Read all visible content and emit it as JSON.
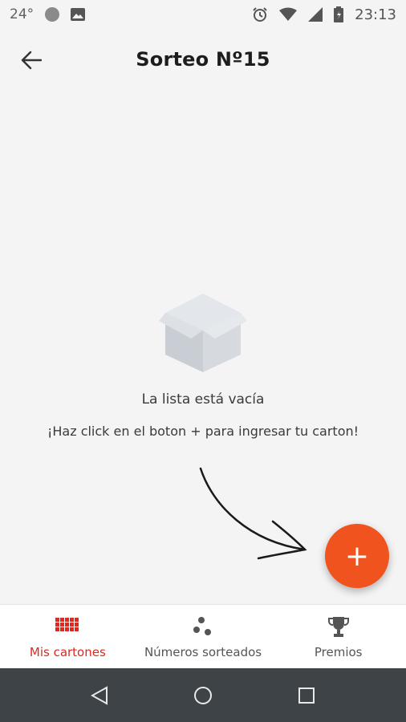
{
  "status_bar": {
    "temperature": "24°",
    "time": "23:13"
  },
  "header": {
    "title": "Sorteo Nº15"
  },
  "empty_state": {
    "title": "La lista está vacía",
    "subtitle": "¡Haz click en el boton + para ingresar tu carton!"
  },
  "fab": {
    "label": "+"
  },
  "bottom_nav": {
    "items": [
      {
        "label": "Mis cartones",
        "icon": "grid-icon",
        "active": true
      },
      {
        "label": "Números sorteados",
        "icon": "dots-icon",
        "active": false
      },
      {
        "label": "Premios",
        "icon": "trophy-icon",
        "active": false
      }
    ]
  },
  "colors": {
    "accent": "#f0531e",
    "active_tab": "#e0281e",
    "background": "#f4f4f4",
    "system_nav": "#3d4346"
  }
}
